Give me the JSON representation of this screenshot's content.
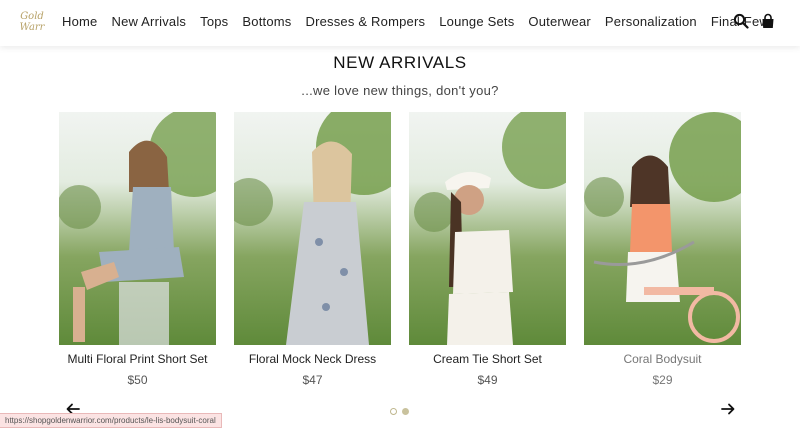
{
  "header": {
    "logo_text": "Golden Warrior",
    "nav": [
      "Home",
      "New Arrivals",
      "Tops",
      "Bottoms",
      "Dresses & Rompers",
      "Lounge Sets",
      "Outerwear",
      "Personalization",
      "Final Few"
    ],
    "search_icon": "search-icon",
    "cart_icon": "shopping-bag-icon"
  },
  "section": {
    "title": "NEW ARRIVALS",
    "subtitle": "...we love new things, don't you?"
  },
  "products": [
    {
      "name": "Multi Floral Print Short Set",
      "price": "$50",
      "outfit_color": "#9fb0bf"
    },
    {
      "name": "Floral Mock Neck Dress",
      "price": "$47",
      "outfit_color": "#c9cdd2"
    },
    {
      "name": "Cream Tie Short Set",
      "price": "$49",
      "outfit_color": "#f4f1ea"
    },
    {
      "name": "Coral Bodysuit",
      "price": "$29",
      "outfit_color": "#f3956b"
    }
  ],
  "carousel": {
    "prev_icon": "arrow-left-icon",
    "next_icon": "arrow-right-icon",
    "pages": 2,
    "active_page": 2
  },
  "status_url": "https://shopgoldenwarrior.com/products/le-lis-bodysuit-coral",
  "colors": {
    "accent": "#c9c29d",
    "background": "#ffffff",
    "text": "#222222"
  }
}
